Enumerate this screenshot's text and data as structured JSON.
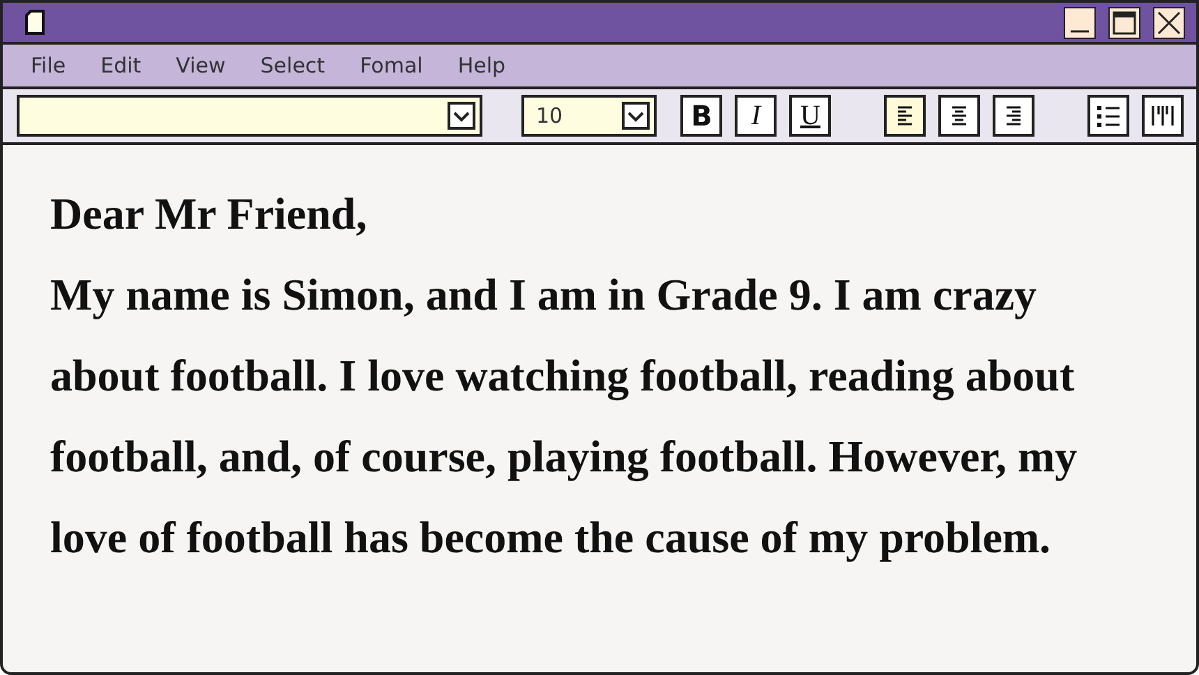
{
  "menu": [
    "File",
    "Edit",
    "View",
    "Select",
    "Fomal",
    "Help"
  ],
  "toolbar": {
    "size_field": {
      "value": "10"
    },
    "style_buttons": [
      {
        "label": "B"
      },
      {
        "label": "I"
      },
      {
        "label": "U"
      }
    ],
    "align_buttons": [
      {
        "kind": "left",
        "selected": true
      },
      {
        "kind": "center",
        "selected": false
      },
      {
        "kind": "right",
        "selected": false
      }
    ],
    "list_buttons": [
      {
        "kind": "bullets"
      },
      {
        "kind": "columns"
      }
    ]
  },
  "document": {
    "greeting": "Dear Mr Friend,",
    "body": "My name is Simon, and I am in Grade 9. I am crazy about football. I love watching football, reading about football, and, of course, playing football. However, my love of football has become the cause of my problem."
  }
}
